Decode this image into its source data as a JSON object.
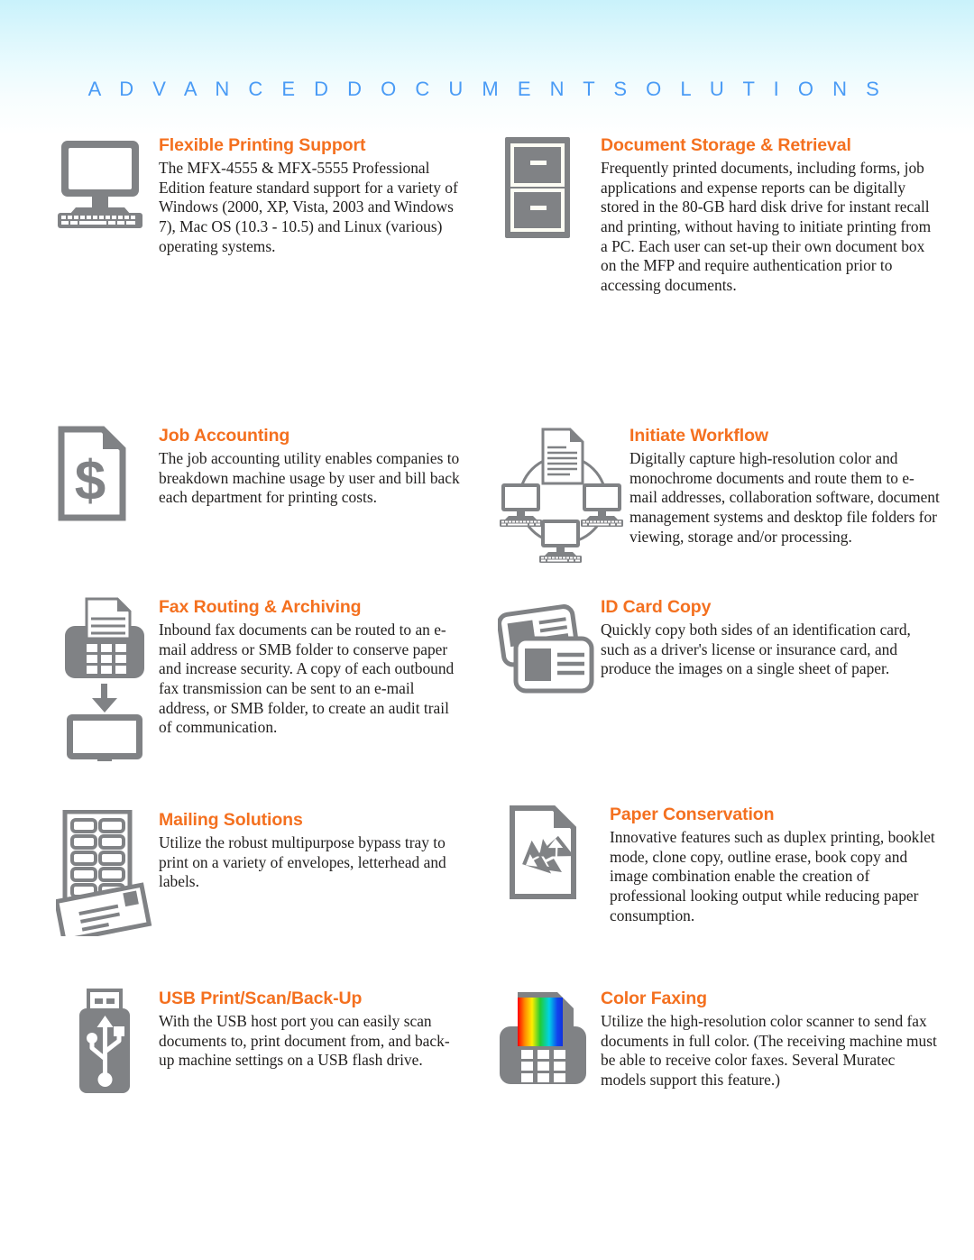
{
  "header": {
    "title": "A D V A N C E D   D O C U M E N T   S O L U T I O N S",
    "title_plain": "ADVANCED DOCUMENT SOLUTIONS",
    "accent_color": "#4a9bf5",
    "band_top_color": "#c9f2fb",
    "band_bottom_color": "#ffffff"
  },
  "theme": {
    "heading_color": "#f4701f",
    "icon_gray": "#808285",
    "body_color": "#211f1e"
  },
  "features": [
    {
      "id": "flexible-printing-support",
      "icon": "desktop-computer-icon",
      "title": "Flexible Printing Support",
      "text": "The MFX-4555 & MFX-5555 Professional Edition feature standard support for a variety of Windows (2000, XP, Vista, 2003 and Windows 7), Mac OS (10.3 - 10.5) and Linux (various) operating systems."
    },
    {
      "id": "document-storage-retrieval",
      "icon": "filing-cabinet-icon",
      "title": "Document Storage & Retrieval",
      "text": "Frequently printed documents, including forms, job applications and expense reports can be digitally stored in the 80-GB hard disk drive for instant recall and printing, without having to initiate printing from a PC. Each user can set-up their own document box on the MFP and require authentication prior to accessing documents."
    },
    {
      "id": "job-accounting",
      "icon": "dollar-document-icon",
      "title": "Job Accounting",
      "text": "The job accounting utility enables companies to breakdown machine usage by user and bill back each department for printing costs."
    },
    {
      "id": "initiate-workflow",
      "icon": "workflow-network-icon",
      "title": "Initiate Workflow",
      "text": "Digitally capture high-resolution color and monochrome documents and route them to e-mail addresses, collaboration software, document management systems and desktop file folders for viewing, storage and/or processing."
    },
    {
      "id": "fax-routing-archiving",
      "icon": "fax-to-computer-icon",
      "title": "Fax Routing & Archiving",
      "text": "Inbound fax documents can be routed to an e-mail address or SMB folder to conserve paper and increase security. A copy of each outbound fax transmission can be sent to an e-mail address, or SMB folder, to create an audit trail of communication."
    },
    {
      "id": "id-card-copy",
      "icon": "id-cards-icon",
      "title": "ID Card Copy",
      "text": "Quickly copy both sides of an identification card, such as a driver's license or insurance card, and produce the images on a single sheet of paper."
    },
    {
      "id": "mailing-solutions",
      "icon": "label-sheet-envelope-icon",
      "title": "Mailing Solutions",
      "text": "Utilize the robust multipurpose bypass tray to print on a variety of envelopes, letterhead and labels."
    },
    {
      "id": "paper-conservation",
      "icon": "recycle-document-icon",
      "title": "Paper Conservation",
      "text": "Innovative features such as duplex printing, booklet mode, clone copy, outline erase, book copy and image combination enable the creation of professional looking output while reducing paper consumption."
    },
    {
      "id": "usb-print-scan-backup",
      "icon": "usb-flash-drive-icon",
      "title": "USB Print/Scan/Back-Up",
      "text": "With the USB host port you can easily scan documents to, print document from, and back-up machine settings on a USB flash drive."
    },
    {
      "id": "color-faxing",
      "icon": "color-fax-icon",
      "title": "Color Faxing",
      "text": "Utilize the high-resolution color scanner to send fax documents in full color. (The receiving machine must be able to receive color faxes. Several Muratec models support this feature.)"
    }
  ]
}
